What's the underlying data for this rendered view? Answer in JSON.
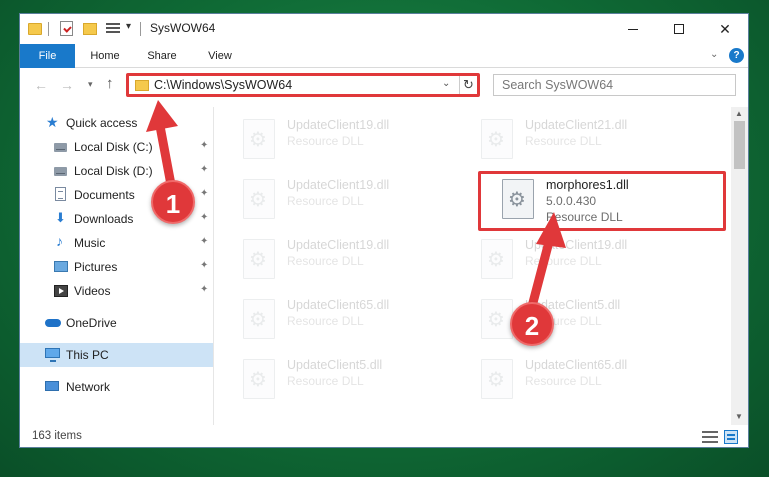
{
  "window": {
    "title": "SysWOW64",
    "controls": {
      "minimize": "—",
      "maximize": "□",
      "close": "✕"
    }
  },
  "ribbon": {
    "tabs": [
      "File",
      "Home",
      "Share",
      "View"
    ],
    "help": "?"
  },
  "nav": {
    "back": "←",
    "forward": "→",
    "recent": "▾",
    "up": "↑",
    "address": "C:\\Windows\\SysWOW64",
    "address_dropdown": "⌄",
    "refresh": "↻",
    "search_placeholder": "Search SysWOW64"
  },
  "sidebar": {
    "items": [
      {
        "label": "Quick access",
        "icon": "star-icon"
      },
      {
        "label": "Local Disk (C:)",
        "icon": "disk-icon",
        "pinned": true
      },
      {
        "label": "Local Disk (D:)",
        "icon": "disk-icon",
        "pinned": true
      },
      {
        "label": "Documents",
        "icon": "documents-icon",
        "pinned": true
      },
      {
        "label": "Downloads",
        "icon": "downloads-icon",
        "pinned": true
      },
      {
        "label": "Music",
        "icon": "music-icon",
        "pinned": true
      },
      {
        "label": "Pictures",
        "icon": "pictures-icon",
        "pinned": true
      },
      {
        "label": "Videos",
        "icon": "videos-icon",
        "pinned": true
      },
      {
        "label": "OneDrive",
        "icon": "onedrive-icon"
      },
      {
        "label": "This PC",
        "icon": "this-pc-icon",
        "selected": true
      },
      {
        "label": "Network",
        "icon": "network-icon"
      }
    ],
    "pin_glyph": "📌"
  },
  "files": [
    {
      "name": "UpdateClient19.dll",
      "type": "Resource DLL"
    },
    {
      "name": "UpdateClient21.dll",
      "type": "Resource DLL"
    },
    {
      "name": "UpdateClient19.dll",
      "type": "Resource DLL"
    },
    {
      "name": "morphores1.dll",
      "version": "5.0.0.430",
      "type": "Resource DLL",
      "highlighted": true
    },
    {
      "name": "UpdateClient19.dll",
      "type": "Resource DLL"
    },
    {
      "name": "UpdateClient19.dll",
      "type": "Resource DLL"
    },
    {
      "name": "UpdateClient65.dll",
      "type": "Resource DLL"
    },
    {
      "name": "UpdateClient5.dll",
      "type": "Resource DLL"
    },
    {
      "name": "UpdateClient5.dll",
      "type": "Resource DLL"
    },
    {
      "name": "UpdateClient65.dll",
      "type": "Resource DLL"
    }
  ],
  "status": {
    "item_count": "163 items"
  },
  "annotations": {
    "step1": "1",
    "step2": "2",
    "color": "#e0383a"
  }
}
